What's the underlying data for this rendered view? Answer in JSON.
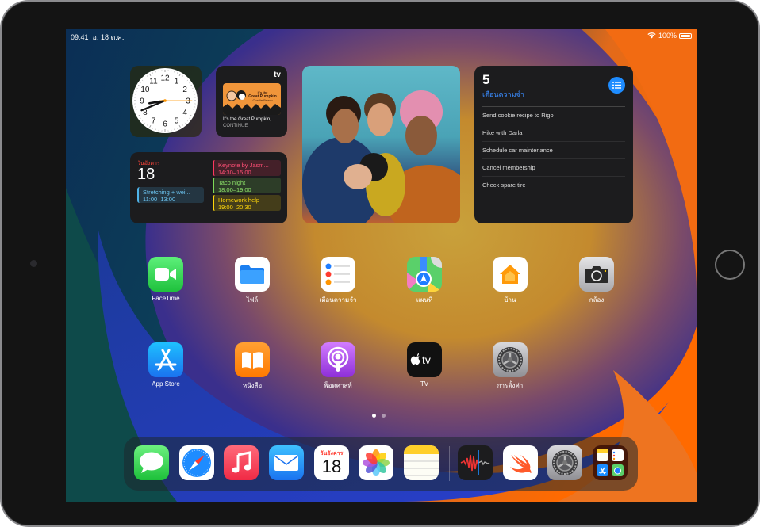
{
  "status_bar": {
    "time": "09:41",
    "date": "อ. 18 ต.ค.",
    "battery_percent": "100%",
    "battery_level": 1.0,
    "wifi_icon": "wifi-icon",
    "battery_icon": "battery-icon"
  },
  "widgets": {
    "clock": {
      "hour": 8,
      "minute": 41,
      "second": 15,
      "numerals": [
        "12",
        "1",
        "2",
        "3",
        "4",
        "5",
        "6",
        "7",
        "8",
        "9",
        "10",
        "11"
      ]
    },
    "tv": {
      "logo": "tv",
      "title": "It's the Great Pumpkin,...",
      "action": "CONTINUE",
      "poster_text": "It's the Great Pumpkin, Charlie Brown"
    },
    "calendar": {
      "weekday": "วันอังคาร",
      "day": "18",
      "events": [
        {
          "title": "Stretching + wei...",
          "time": "11:00–13:00",
          "color": "#4fb3e8"
        },
        {
          "title": "Keynote by Jasm...",
          "time": "14:30–15:00",
          "color": "#ff375f"
        },
        {
          "title": "Taco night",
          "time": "18:00–19:00",
          "color": "#7ed957"
        },
        {
          "title": "Homework help",
          "time": "19:00–20:30",
          "color": "#ffd60a"
        }
      ]
    },
    "photo": {
      "description": "Group selfie of four smiling friends"
    },
    "reminders": {
      "count": "5",
      "title": "เตือนความจำ",
      "items": [
        "Send cookie recipe to Rigo",
        "Hike with Darla",
        "Schedule car maintenance",
        "Cancel membership",
        "Check spare tire"
      ]
    }
  },
  "apps": [
    {
      "name": "FaceTime",
      "icon": "facetime-icon"
    },
    {
      "name": "ไฟล์",
      "icon": "files-icon"
    },
    {
      "name": "เตือนความจำ",
      "icon": "reminders-icon"
    },
    {
      "name": "แผนที่",
      "icon": "maps-icon"
    },
    {
      "name": "บ้าน",
      "icon": "home-icon"
    },
    {
      "name": "กล้อง",
      "icon": "camera-icon"
    },
    {
      "name": "App Store",
      "icon": "app-store-icon"
    },
    {
      "name": "หนังสือ",
      "icon": "books-icon"
    },
    {
      "name": "พ็อดคาสท์",
      "icon": "podcasts-icon"
    },
    {
      "name": "TV",
      "icon": "tv-icon"
    },
    {
      "name": "การตั้งค่า",
      "icon": "settings-icon"
    }
  ],
  "page_indicator": {
    "current": 1,
    "total": 2
  },
  "dock": {
    "apps": [
      "Messages",
      "Safari",
      "Music",
      "Mail",
      "Calendar",
      "Photos",
      "Notes"
    ],
    "recent": [
      "Voice Memos",
      "Swift Playgrounds",
      "Settings",
      "App Library"
    ],
    "calendar_weekday": "วันอังคาร",
    "calendar_day": "18"
  }
}
